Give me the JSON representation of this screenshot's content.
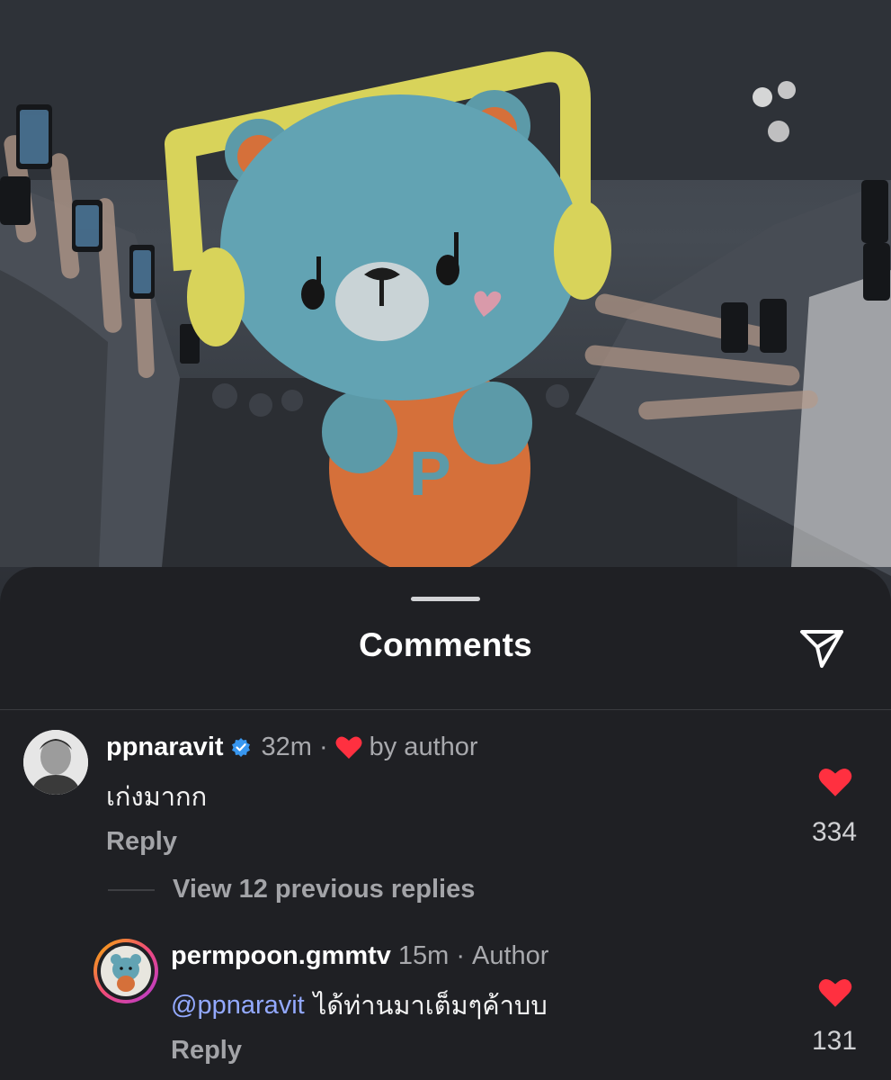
{
  "photo": {
    "description_icon": "mascot-photo"
  },
  "sheet": {
    "title": "Comments",
    "share_icon": "paper-plane-icon"
  },
  "comments": [
    {
      "username": "ppnaravit",
      "verified": true,
      "time": "32m",
      "separator": "·",
      "liked_by_author": "by author",
      "text": "เก่งมากก",
      "reply_label": "Reply",
      "likes": "334"
    }
  ],
  "view_replies": "View 12 previous replies",
  "replies": [
    {
      "username": "permpoon.gmmtv",
      "time": "15m",
      "separator": "·",
      "role": "Author",
      "mention": "@ppnaravit",
      "text": "ได้ท่านมาเต็มๆค้าบบ",
      "reply_label": "Reply",
      "likes": "131"
    }
  ],
  "colors": {
    "like_red": "#ff3040",
    "verified_blue": "#3897f0",
    "mention_blue": "#93a9ff",
    "sheet_bg": "#1f2024"
  }
}
